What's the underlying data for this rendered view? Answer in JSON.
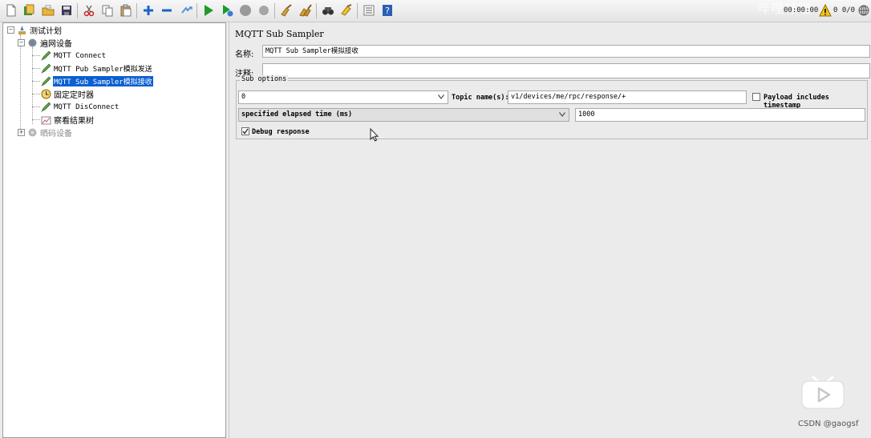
{
  "toolbar": {
    "timer": "00:00:00",
    "warning_count": "0 0/0",
    "watermark": "哔哩哔哩"
  },
  "tree": {
    "items": [
      {
        "label": "测试计划"
      },
      {
        "label": "遍网设备"
      },
      {
        "label": "MQTT Connect"
      },
      {
        "label": "MQTT Pub Sampler模拟发送"
      },
      {
        "label": "MQTT Sub Sampler模拟接收"
      },
      {
        "label": "固定定时器"
      },
      {
        "label": "MQTT DisConnect"
      },
      {
        "label": "察看结果树"
      },
      {
        "label": "晒码设备"
      }
    ]
  },
  "sampler": {
    "title": "MQTT Sub Sampler",
    "name_label": "名称:",
    "name_value": "MQTT Sub Sampler模拟接收",
    "comment_label": "注释:",
    "comment_value": "",
    "sub_options": {
      "legend": "Sub options",
      "qos_value": "0",
      "topic_label": "Topic name(s):",
      "topic_value": "v1/devices/me/rpc/response/+",
      "payload_ts_label": "Payload includes timestamp",
      "payload_ts_checked": false,
      "mode_value": "specified elapsed time (ms)",
      "elapsed_value": "1000",
      "debug_label": "Debug response",
      "debug_checked": true
    }
  },
  "footer": {
    "credit": "CSDN @gaogsf"
  },
  "colors": {
    "selection": "#0a5fd1",
    "run_green": "#1c9b2c",
    "add_blue": "#1b63c8"
  }
}
